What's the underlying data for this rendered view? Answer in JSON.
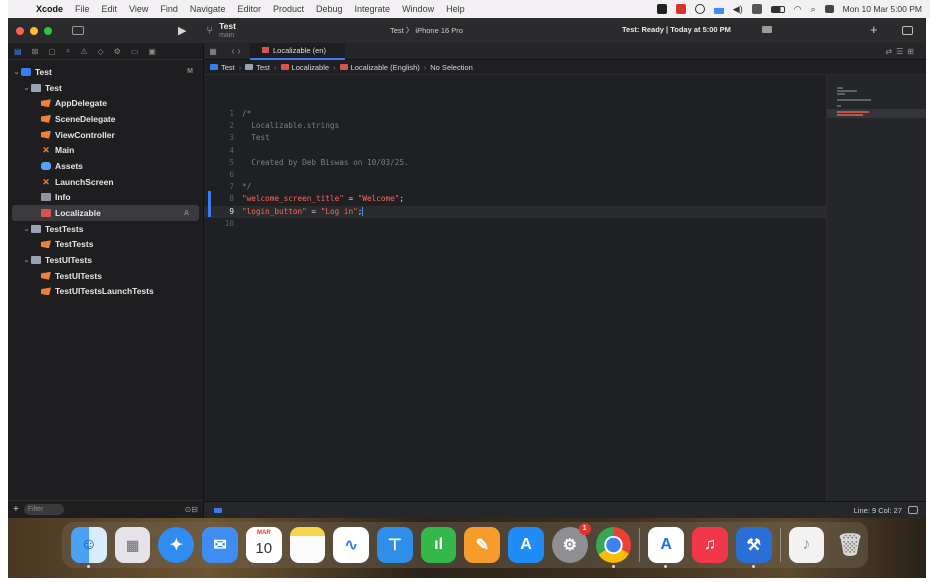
{
  "menubar": {
    "apple": "",
    "app_name": "Xcode",
    "menus": [
      "File",
      "Edit",
      "View",
      "Find",
      "Navigate",
      "Editor",
      "Product",
      "Debug",
      "Integrate",
      "Window",
      "Help"
    ],
    "clock": "Mon 10 Mar 5:00 PM"
  },
  "toolbar": {
    "project_name": "Test",
    "branch": "main",
    "scheme": "Test 〉 iPhone 16 Pro",
    "status": "Test: Ready | Today at 5:00 PM",
    "add_label": "+"
  },
  "navigator": {
    "tree": [
      {
        "label": "Test",
        "icon": "project",
        "expanded": true,
        "depth": 0,
        "badge": "M"
      },
      {
        "label": "Test",
        "icon": "folder",
        "expanded": true,
        "depth": 1
      },
      {
        "label": "AppDelegate",
        "icon": "swift",
        "depth": 2
      },
      {
        "label": "SceneDelegate",
        "icon": "swift",
        "depth": 2
      },
      {
        "label": "ViewController",
        "icon": "swift",
        "depth": 2
      },
      {
        "label": "Main",
        "icon": "storyboard",
        "depth": 2
      },
      {
        "label": "Assets",
        "icon": "assets",
        "depth": 2
      },
      {
        "label": "LaunchScreen",
        "icon": "storyboard",
        "depth": 2
      },
      {
        "label": "Info",
        "icon": "plist",
        "depth": 2
      },
      {
        "label": "Localizable",
        "icon": "strings",
        "depth": 2,
        "selected": true,
        "badge": "A"
      },
      {
        "label": "TestTests",
        "icon": "folder",
        "expanded": true,
        "depth": 1
      },
      {
        "label": "TestTests",
        "icon": "swift",
        "depth": 2
      },
      {
        "label": "TestUITests",
        "icon": "folder",
        "expanded": true,
        "depth": 1
      },
      {
        "label": "TestUITests",
        "icon": "swift",
        "depth": 2
      },
      {
        "label": "TestUITestsLaunchTests",
        "icon": "swift",
        "depth": 2
      }
    ],
    "filter_placeholder": "Filter"
  },
  "editor": {
    "tab_label": "Localizable (en)",
    "jumpbar": [
      "Test",
      "Test",
      "Localizable",
      "Localizable (English)",
      "No Selection"
    ],
    "lines": [
      {
        "n": "1",
        "text": "/*",
        "kind": "cmt"
      },
      {
        "n": "2",
        "text": "  Localizable.strings",
        "kind": "cmt"
      },
      {
        "n": "3",
        "text": "  Test",
        "kind": "cmt"
      },
      {
        "n": "4",
        "text": "",
        "kind": "cmt"
      },
      {
        "n": "5",
        "text": "  Created by Deb Biswas on 10/03/25.",
        "kind": "cmt"
      },
      {
        "n": "6",
        "text": "",
        "kind": "cmt"
      },
      {
        "n": "7",
        "text": "*/",
        "kind": "cmt"
      },
      {
        "n": "8",
        "key": "\"welcome_screen_title\"",
        "eq": " = ",
        "value": "\"Welcome\"",
        "end": ";",
        "kind": "kv"
      },
      {
        "n": "9",
        "key": "\"login_button\"",
        "eq": " = ",
        "value": "\"Log in\"",
        "end": ";",
        "kind": "kv",
        "current": true
      },
      {
        "n": "10",
        "text": "",
        "kind": "plain"
      }
    ]
  },
  "statusbar": {
    "position": "Line: 9  Col: 27"
  },
  "dock": {
    "calendar_month": "MAR",
    "calendar_day": "10",
    "settings_badge": "1"
  },
  "colors": {
    "accent": "#3a7df0",
    "string": "#fc6a5d",
    "comment": "#74808c"
  }
}
